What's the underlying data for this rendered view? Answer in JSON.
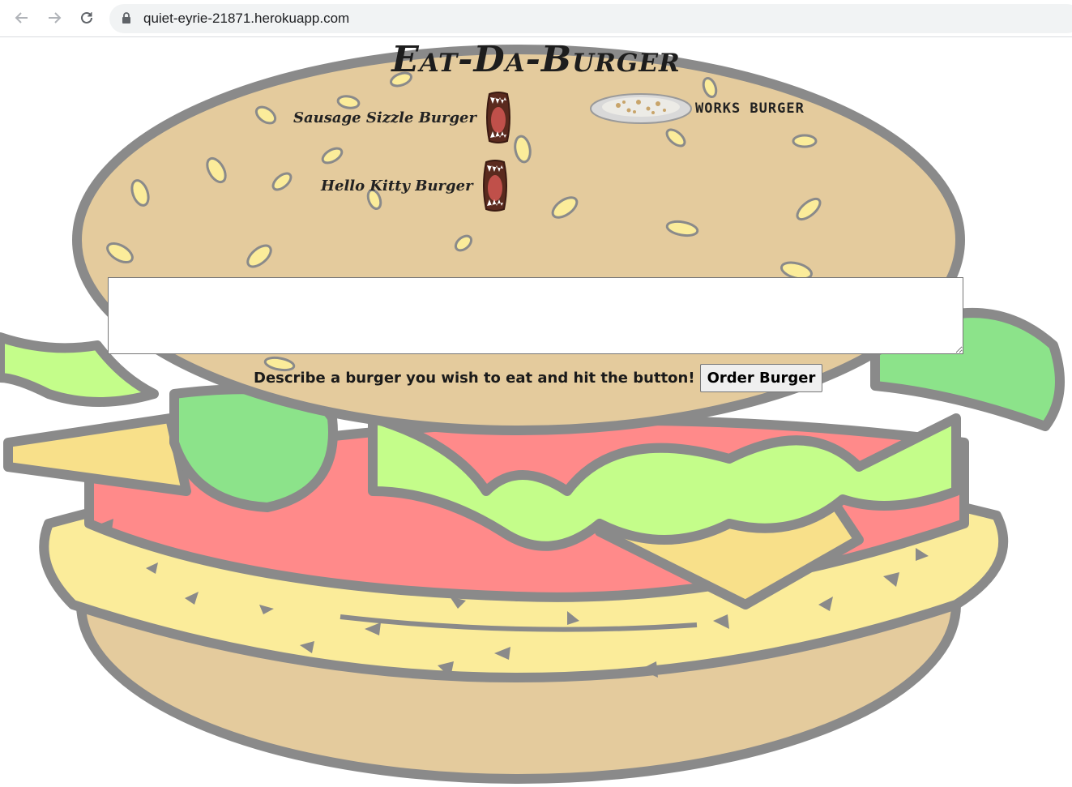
{
  "browser": {
    "url": "quiet-eyrie-21871.herokuapp.com",
    "icons": [
      "back-arrow-icon",
      "forward-arrow-icon",
      "reload-icon",
      "lock-icon"
    ]
  },
  "page": {
    "title": "Eat-Da-Burger",
    "burgers_to_eat": [
      {
        "name": "Sausage Sizzle Burger",
        "icon": "open-mouth-icon"
      },
      {
        "name": "Hello Kitty Burger",
        "icon": "open-mouth-icon"
      }
    ],
    "devoured_burgers": [
      {
        "name": "WORKS BURGER",
        "icon": "empty-plate-icon"
      }
    ],
    "form": {
      "textarea_value": "",
      "prompt": "Describe a burger you wish to eat and hit the button!",
      "button_label": "Order Burger"
    }
  },
  "colors": {
    "bun": "#e4cb9d",
    "outline": "#8a8a8a",
    "lettuce": "#c4fd8a",
    "pickle": "#8ce38a",
    "tomato": "#ff8a8a",
    "cheese": "#f8e08a",
    "seed": "#fbec9a"
  }
}
